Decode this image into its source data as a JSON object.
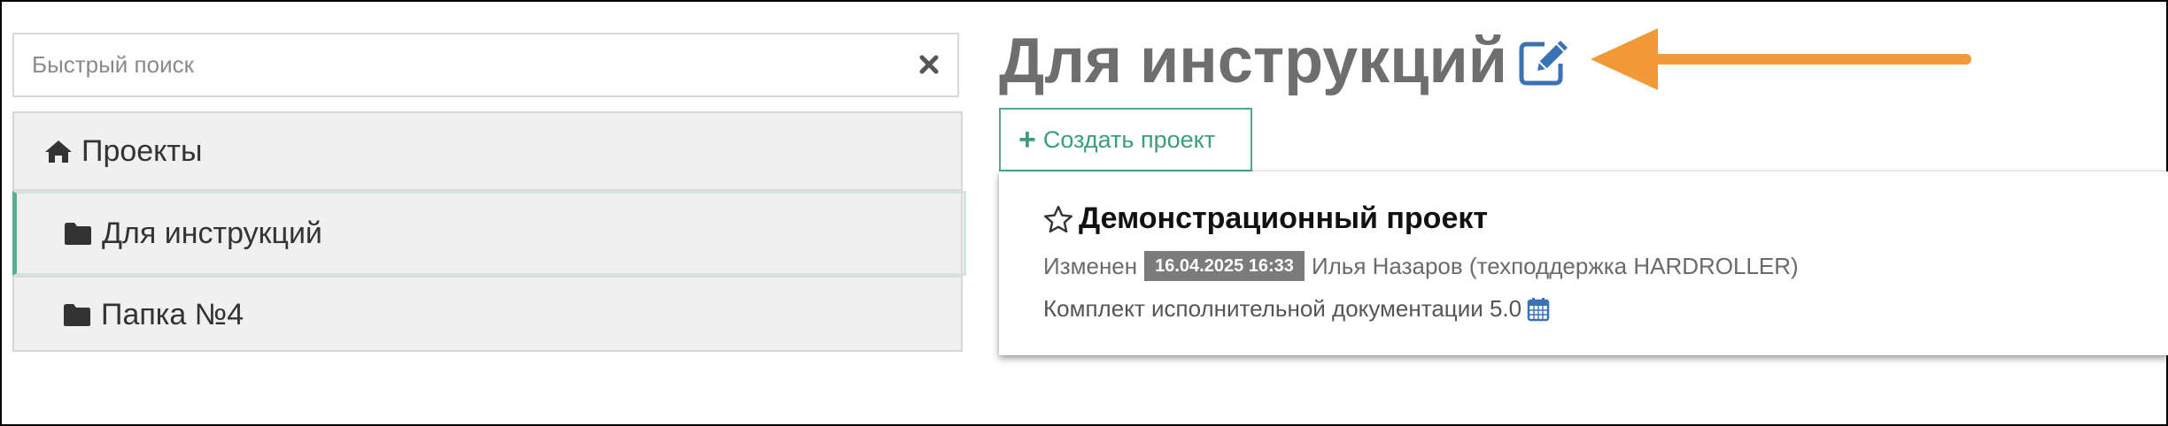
{
  "search": {
    "placeholder": "Быстрый поиск",
    "value": "",
    "clear_icon": "times-icon"
  },
  "tree": {
    "items": [
      {
        "label": "Проекты",
        "icon": "home-icon",
        "level": 0,
        "selected": false
      },
      {
        "label": "Для инструкций",
        "icon": "folder-icon",
        "level": 1,
        "selected": true
      },
      {
        "label": "Папка №4",
        "icon": "folder-icon",
        "level": 1,
        "selected": false
      }
    ]
  },
  "header": {
    "title": "Для инструкций",
    "edit_icon": "pencil-square-icon",
    "annotation": "arrow-left"
  },
  "create_button": {
    "label": "Создать проект",
    "icon": "plus-icon"
  },
  "project": {
    "star_icon": "star-outline-icon",
    "title": "Демонстрационный проект",
    "modified_label": "Изменен",
    "modified_date": "16.04.2025 16:33",
    "modified_by": "Илья Назаров (техподдержка HARDROLLER)",
    "description": "Комплект исполнительной документации 5.0",
    "calendar_icon": "calendar-icon"
  },
  "colors": {
    "accent_green": "#4cae88",
    "edit_blue": "#3a72b5",
    "arrow_orange": "#f29a38",
    "badge_gray": "#7b7b7b",
    "title_gray": "#6e6e6e"
  }
}
